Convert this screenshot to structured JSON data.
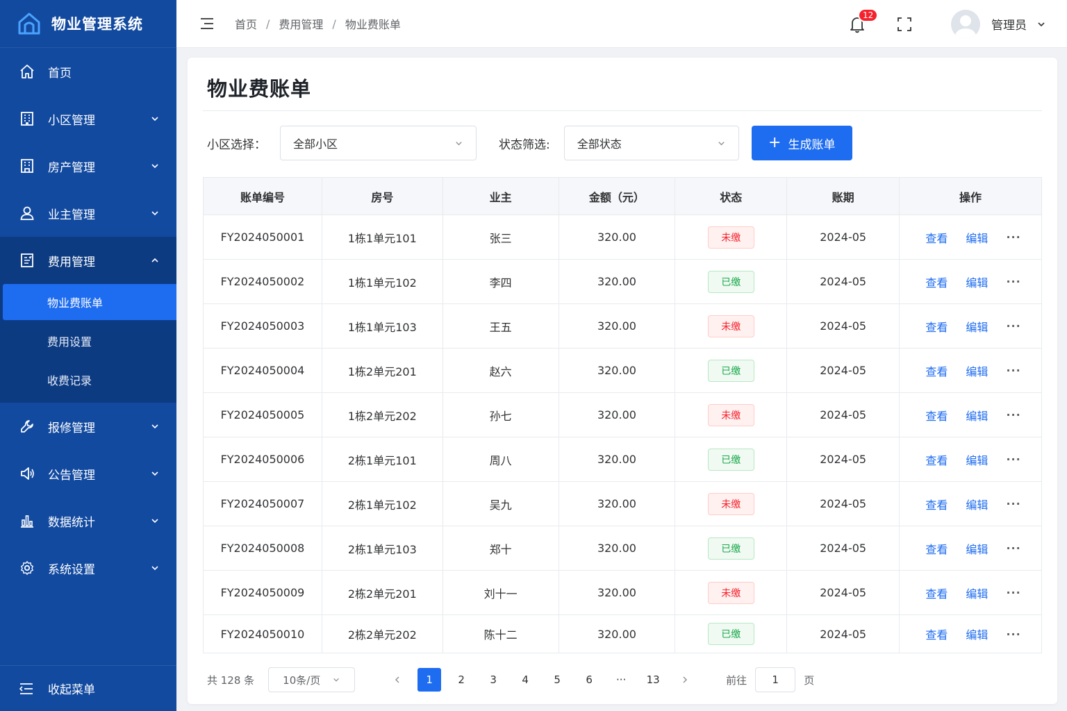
{
  "app": {
    "title": "物业管理系统",
    "brand_color": "#1e6cf0",
    "sidebar_color": "#124aa0"
  },
  "sidebar": {
    "items": [
      {
        "label": "首页",
        "icon": "home-icon"
      },
      {
        "label": "小区管理",
        "icon": "building-icon"
      },
      {
        "label": "房产管理",
        "icon": "property-icon"
      },
      {
        "label": "业主管理",
        "icon": "user-icon"
      },
      {
        "label": "费用管理",
        "icon": "bill-icon",
        "expanded": true
      },
      {
        "label": "报修管理",
        "icon": "wrench-icon"
      },
      {
        "label": "公告管理",
        "icon": "megaphone-icon"
      },
      {
        "label": "数据统计",
        "icon": "bar-chart-icon"
      },
      {
        "label": "系统设置",
        "icon": "gear-icon"
      }
    ],
    "submenu": [
      {
        "label": "物业费账单",
        "active": true
      },
      {
        "label": "费用设置"
      },
      {
        "label": "收费记录"
      }
    ],
    "collapse_label": "收起菜单"
  },
  "header": {
    "breadcrumb": [
      "首页",
      "费用管理",
      "物业费账单"
    ],
    "notification_count": "12",
    "username": "管理员"
  },
  "page": {
    "title": "物业费账单",
    "filters": {
      "community_label": "小区选择：",
      "community_value": "全部小区",
      "status_label": "状态筛选:",
      "status_value": "全部状态",
      "generate_button": "生成账单"
    }
  },
  "table": {
    "columns": [
      "账单编号",
      "房号",
      "业主",
      "金额（元）",
      "状态",
      "账期",
      "操作"
    ],
    "actions": {
      "view": "查看",
      "edit": "编辑",
      "more": "···"
    },
    "rows": [
      {
        "id": "FY2024050001",
        "room": "1栋1单元101",
        "owner": "张三",
        "amount": "320.00",
        "status": "未缴",
        "paid": false,
        "period": "2024-05"
      },
      {
        "id": "FY2024050002",
        "room": "1栋1单元102",
        "owner": "李四",
        "amount": "320.00",
        "status": "已缴",
        "paid": true,
        "period": "2024-05"
      },
      {
        "id": "FY2024050003",
        "room": "1栋1单元103",
        "owner": "王五",
        "amount": "320.00",
        "status": "未缴",
        "paid": false,
        "period": "2024-05"
      },
      {
        "id": "FY2024050004",
        "room": "1栋2单元201",
        "owner": "赵六",
        "amount": "320.00",
        "status": "已缴",
        "paid": true,
        "period": "2024-05"
      },
      {
        "id": "FY2024050005",
        "room": "1栋2单元202",
        "owner": "孙七",
        "amount": "320.00",
        "status": "未缴",
        "paid": false,
        "period": "2024-05"
      },
      {
        "id": "FY2024050006",
        "room": "2栋1单元101",
        "owner": "周八",
        "amount": "320.00",
        "status": "已缴",
        "paid": true,
        "period": "2024-05"
      },
      {
        "id": "FY2024050007",
        "room": "2栋1单元102",
        "owner": "吴九",
        "amount": "320.00",
        "status": "未缴",
        "paid": false,
        "period": "2024-05"
      },
      {
        "id": "FY2024050008",
        "room": "2栋1单元103",
        "owner": "郑十",
        "amount": "320.00",
        "status": "已缴",
        "paid": true,
        "period": "2024-05"
      },
      {
        "id": "FY2024050009",
        "room": "2栋2单元201",
        "owner": "刘十一",
        "amount": "320.00",
        "status": "未缴",
        "paid": false,
        "period": "2024-05"
      },
      {
        "id": "FY2024050010",
        "room": "2栋2单元202",
        "owner": "陈十二",
        "amount": "320.00",
        "status": "已缴",
        "paid": true,
        "period": "2024-05"
      }
    ]
  },
  "pagination": {
    "total": "共 128 条",
    "page_size": "10条/页",
    "pages": [
      "1",
      "2",
      "3",
      "4",
      "5",
      "6",
      "···",
      "13"
    ],
    "current": "1",
    "goto_prefix": "前往",
    "goto_value": "1",
    "goto_suffix": "页"
  }
}
